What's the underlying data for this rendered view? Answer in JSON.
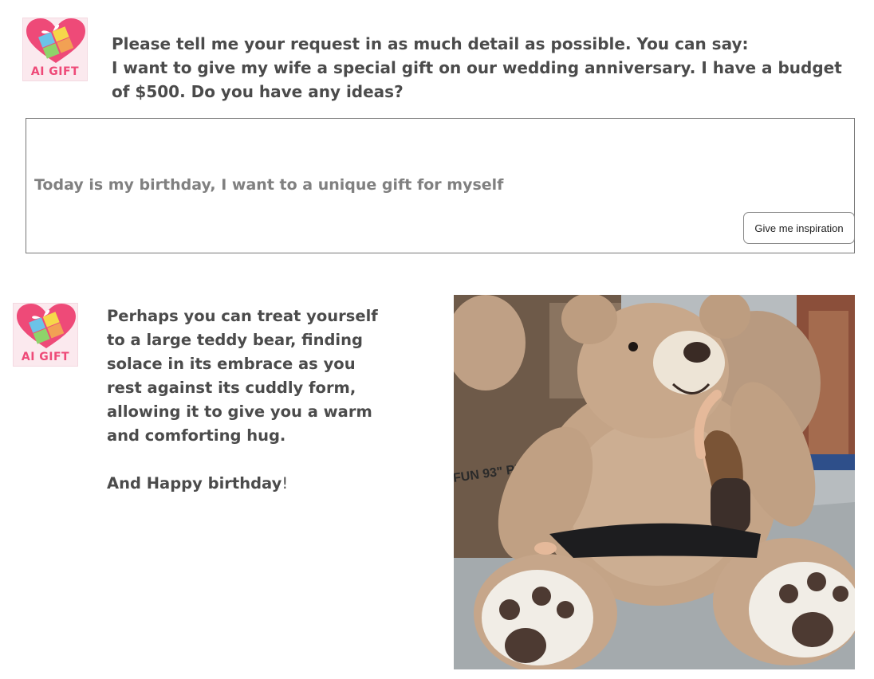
{
  "logo": {
    "text": "AI GIFT"
  },
  "prompt": {
    "lines": [
      "Please tell me your request in as much detail as possible. You can say:",
      "I want to give my wife a special gift on our wedding anniversary. I have a budget",
      "of $500. Do you have any ideas?"
    ]
  },
  "input": {
    "value": "Today is my birthday, I want to a unique gift for myself"
  },
  "button": {
    "label": "Give me inspiration"
  },
  "answer": {
    "lines": [
      "Perhaps you can treat yourself",
      "to a large teddy bear, finding",
      "solace in its embrace as you",
      "rest against its cuddly form,",
      "allowing it to give you a warm",
      "and comforting hug."
    ],
    "closing": "And Happy birthday",
    "closing_mark": "!"
  },
  "photo": {
    "box_text": "FUN 93\" PLUSH"
  }
}
